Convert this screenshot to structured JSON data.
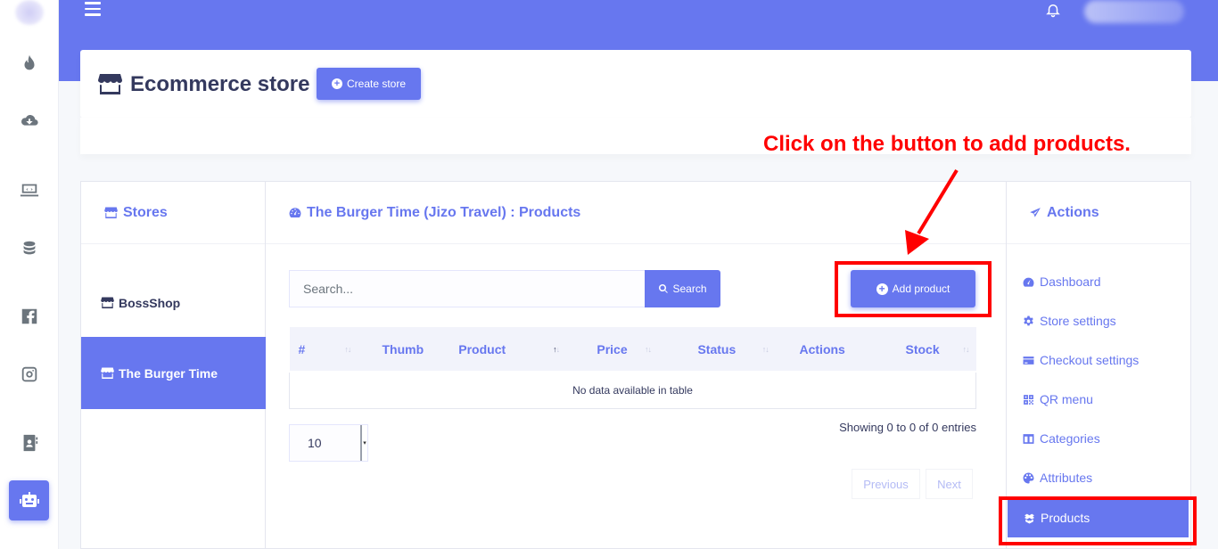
{
  "header": {
    "title": "Ecommerce store",
    "create_store_label": "Create store"
  },
  "annotation": {
    "text": "Click on the button to add products."
  },
  "stores_panel": {
    "title": "Stores",
    "items": [
      {
        "label": "BossShop",
        "active": false
      },
      {
        "label": "The Burger Time",
        "active": true
      }
    ]
  },
  "products_panel": {
    "title": "The Burger Time (Jizo Travel) : Products",
    "search_placeholder": "Search...",
    "search_button": "Search",
    "add_product_button": "Add product",
    "columns": [
      "#",
      "Thumb",
      "Product",
      "Price",
      "Status",
      "Actions",
      "Stock"
    ],
    "empty_message": "No data available in table",
    "page_length": "10",
    "info": "Showing 0 to 0 of 0 entries",
    "previous": "Previous",
    "next": "Next"
  },
  "actions_panel": {
    "title": "Actions",
    "items": [
      {
        "label": "Dashboard",
        "icon": "gauge-icon"
      },
      {
        "label": "Store settings",
        "icon": "gear-icon"
      },
      {
        "label": "Checkout settings",
        "icon": "credit-card-icon"
      },
      {
        "label": "QR menu",
        "icon": "qrcode-icon"
      },
      {
        "label": "Categories",
        "icon": "columns-icon"
      },
      {
        "label": "Attributes",
        "icon": "palette-icon"
      },
      {
        "label": "Products",
        "icon": "box-open-icon",
        "active": true
      }
    ]
  },
  "colors": {
    "primary": "#6777ef",
    "annotation_red": "#ff0000",
    "text_dark": "#34395e"
  }
}
